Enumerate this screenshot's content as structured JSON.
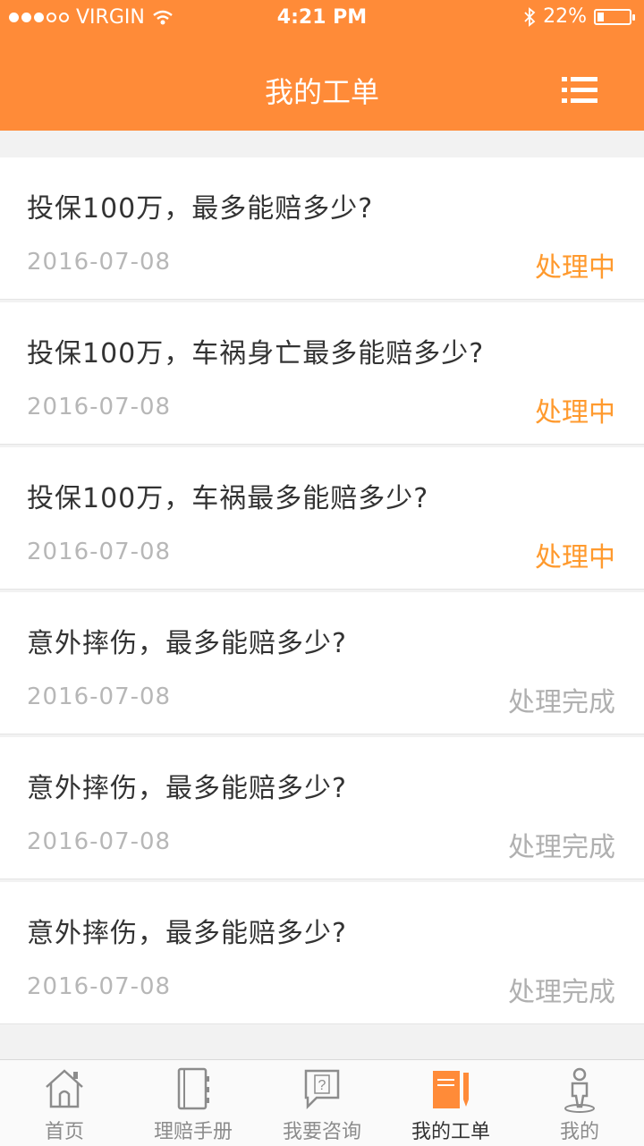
{
  "status_bar": {
    "carrier": "VIRGIN",
    "time": "4:21 PM",
    "battery": "22%"
  },
  "header": {
    "title": "我的工单"
  },
  "tickets": [
    {
      "question": "投保100万，最多能赔多少?",
      "date": "2016-07-08",
      "status": "处理中",
      "state": "processing"
    },
    {
      "question": "投保100万，车祸身亡最多能赔多少?",
      "date": "2016-07-08",
      "status": "处理中",
      "state": "processing"
    },
    {
      "question": "投保100万，车祸最多能赔多少?",
      "date": "2016-07-08",
      "status": "处理中",
      "state": "processing"
    },
    {
      "question": "意外摔伤，最多能赔多少?",
      "date": "2016-07-08",
      "status": "处理完成",
      "state": "done"
    },
    {
      "question": "意外摔伤，最多能赔多少?",
      "date": "2016-07-08",
      "status": "处理完成",
      "state": "done"
    },
    {
      "question": "意外摔伤，最多能赔多少?",
      "date": "2016-07-08",
      "status": "处理完成",
      "state": "done"
    }
  ],
  "tabs": [
    {
      "label": "首页",
      "icon": "home-icon"
    },
    {
      "label": "理赔手册",
      "icon": "book-icon"
    },
    {
      "label": "我要咨询",
      "icon": "question-icon"
    },
    {
      "label": "我的工单",
      "icon": "ticket-icon",
      "active": true
    },
    {
      "label": "我的",
      "icon": "user-icon"
    }
  ],
  "colors": {
    "accent": "#ff8b38",
    "processing": "#ff9a2e",
    "done": "#b0b0b0"
  }
}
